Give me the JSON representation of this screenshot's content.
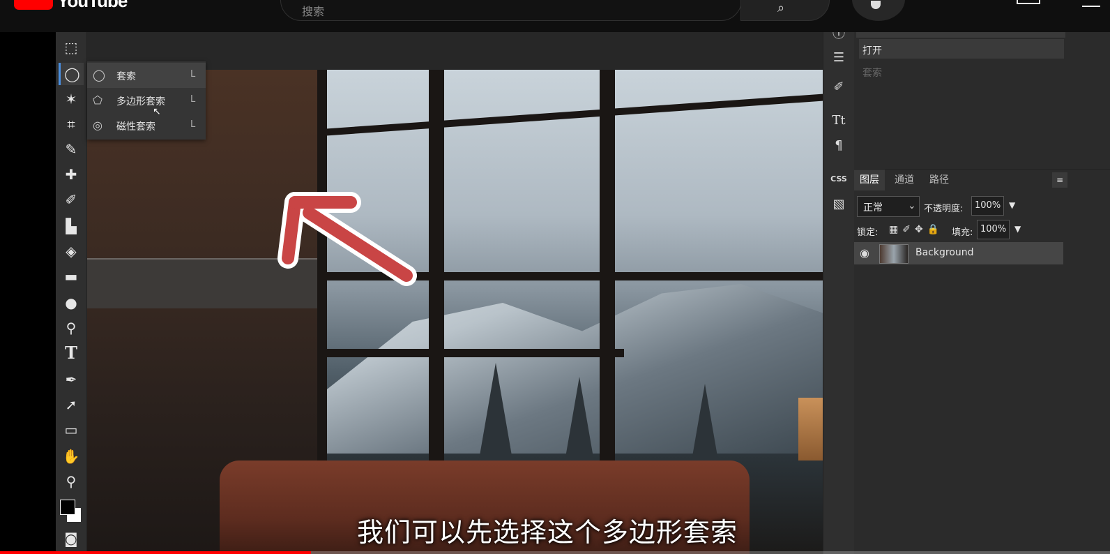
{
  "youtube": {
    "logo_text": "YouTube",
    "search_placeholder": "搜索"
  },
  "flyout": {
    "items": [
      {
        "label": "套索",
        "key": "L"
      },
      {
        "label": "多边形套索",
        "key": "L"
      },
      {
        "label": "磁性套索",
        "key": "L"
      }
    ]
  },
  "history": {
    "items": [
      "打开",
      "套索"
    ]
  },
  "right_icons": {
    "css_label": "CSS"
  },
  "layers_panel": {
    "tabs": [
      "图层",
      "通道",
      "路径"
    ],
    "blend_mode": "正常",
    "opacity_label": "不透明度:",
    "opacity_value": "100%",
    "lock_label": "锁定:",
    "fill_label": "填充:",
    "fill_value": "100%",
    "layers": [
      {
        "name": "Background"
      }
    ]
  },
  "subtitle": "我们可以先选择这个多边形套索",
  "video_progress": 0.28,
  "colors": {
    "youtube_red": "#ff0000",
    "active_tool_accent": "#4a90e2",
    "arrow_red": "#c94545"
  }
}
